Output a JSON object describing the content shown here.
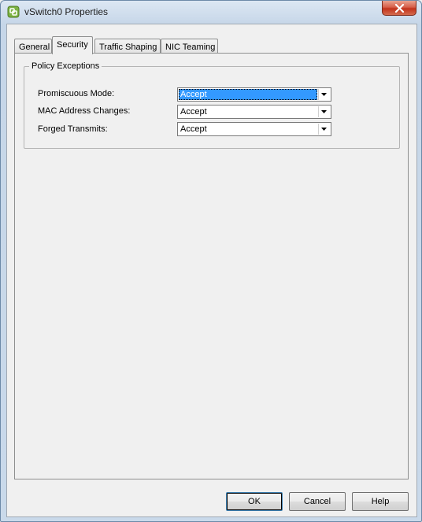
{
  "window": {
    "title": "vSwitch0 Properties"
  },
  "tabs": [
    {
      "label": "General"
    },
    {
      "label": "Security"
    },
    {
      "label": "Traffic Shaping"
    },
    {
      "label": "NIC Teaming"
    }
  ],
  "active_tab": "Security",
  "policy": {
    "legend": "Policy Exceptions",
    "rows": [
      {
        "label": "Promiscuous Mode:",
        "value": "Accept"
      },
      {
        "label": "MAC Address Changes:",
        "value": "Accept"
      },
      {
        "label": "Forged Transmits:",
        "value": "Accept"
      }
    ]
  },
  "buttons": {
    "ok": "OK",
    "cancel": "Cancel",
    "help": "Help"
  },
  "icons": {
    "app": "vsphere-network-icon",
    "close": "close-icon",
    "dropdown": "chevron-down-icon"
  },
  "colors": {
    "selection": "#3399ff",
    "close_button": "#c2331b"
  }
}
